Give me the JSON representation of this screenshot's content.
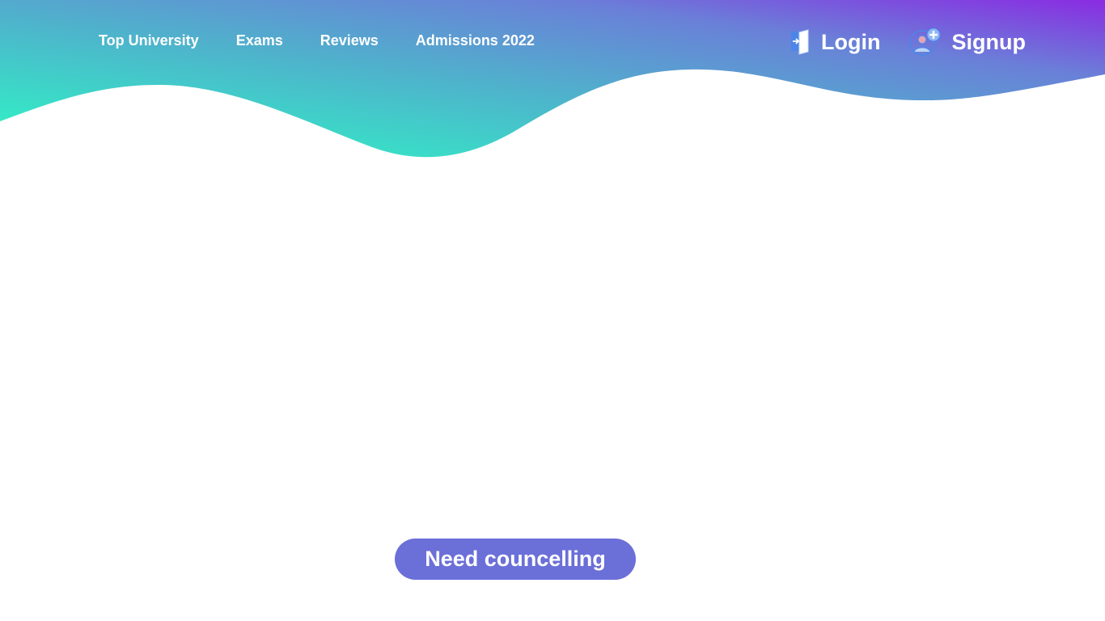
{
  "nav": {
    "items": [
      {
        "label": "Top University"
      },
      {
        "label": "Exams"
      },
      {
        "label": "Reviews"
      },
      {
        "label": "Admissions 2022"
      }
    ]
  },
  "auth": {
    "login": {
      "label": "Login",
      "icon": "login-door-icon"
    },
    "signup": {
      "label": "Signup",
      "icon": "add-user-icon"
    }
  },
  "cta": {
    "label": "Need councelling"
  },
  "colors": {
    "header_gradient_start": "#2bfbc4",
    "header_gradient_mid": "#5aa2d0",
    "header_gradient_end": "#8a2be2",
    "button": "#6b6fd8",
    "text": "#ffffff",
    "background": "#ffffff"
  }
}
